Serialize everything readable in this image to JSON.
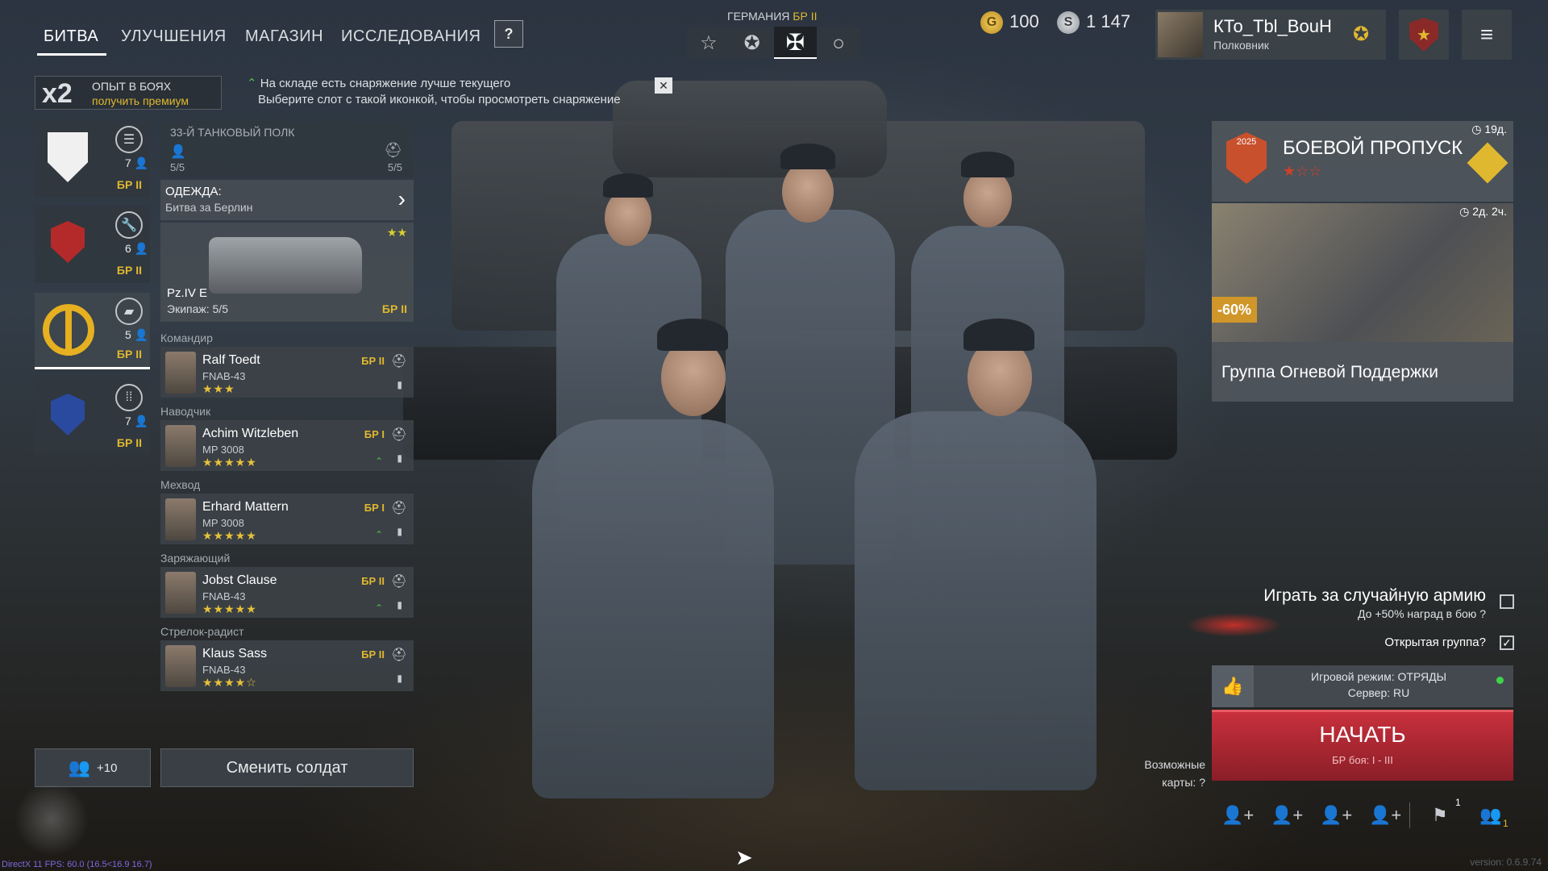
{
  "colors": {
    "accent_gold": "#e0b830",
    "start_red": "#c0303a",
    "bp_orange": "#c8502d",
    "online_green": "#3fd24a"
  },
  "nav": {
    "tabs": [
      "БИТВА",
      "УЛУЧШЕНИЯ",
      "МАГАЗИН",
      "ИССЛЕДОВАНИЯ"
    ],
    "help": "?"
  },
  "nation": {
    "name": "ГЕРМАНИЯ",
    "br": "БР II",
    "icons": [
      "star-icon",
      "circle-star-icon",
      "cross-icon",
      "circle-icon"
    ]
  },
  "currency": {
    "gold": "100",
    "silver": "1 147"
  },
  "player": {
    "name": "КТо_Tbl_BouH",
    "rank": "Полковник"
  },
  "xp_bonus": {
    "multiplier": "2",
    "label": "ОПЫТ В БОЯХ",
    "link": "получить премиум"
  },
  "notice": {
    "line1": "На складе есть снаряжение лучше текущего",
    "line2": "Выберите слот с такой иконкой, чтобы просмотреть снаряжение",
    "close": "✕"
  },
  "squads": [
    {
      "count": "7",
      "br": "БР II"
    },
    {
      "count": "6",
      "br": "БР II"
    },
    {
      "count": "5",
      "br": "БР II"
    },
    {
      "count": "7",
      "br": "БР II"
    }
  ],
  "regiment": {
    "name": "33-Й ТАНКОВЫЙ ПОЛК",
    "soldiers": "5/5",
    "vehicles": "5/5"
  },
  "outfit": {
    "label": "ОДЕЖДА:",
    "value": "Битва за Берлин"
  },
  "vehicle": {
    "name": "Pz.IV E",
    "crew": "Экипаж: 5/5",
    "br": "БР II",
    "stars": "★★"
  },
  "soldiers": [
    {
      "role": "Командир",
      "name": "Ralf Toedt",
      "weapon": "FNAB-43",
      "stars": "★★★",
      "br": "БР II"
    },
    {
      "role": "Наводчик",
      "name": "Achim Witzleben",
      "weapon": "MP 3008",
      "stars": "★★★★★",
      "br": "БР I"
    },
    {
      "role": "Мехвод",
      "name": "Erhard Mattern",
      "weapon": "MP 3008",
      "stars": "★★★★★",
      "br": "БР I"
    },
    {
      "role": "Заряжающий",
      "name": "Jobst Clause",
      "weapon": "FNAB-43",
      "stars": "★★★★★",
      "br": "БР II"
    },
    {
      "role": "Стрелок-радист",
      "name": "Klaus Sass",
      "weapon": "FNAB-43",
      "stars": "★★★★☆",
      "br": "БР II"
    }
  ],
  "squad_bottom": {
    "add_count": "+10",
    "change_button": "Сменить солдат"
  },
  "battle_pass": {
    "title": "БОЕВОЙ ПРОПУСК",
    "timer": "19д.",
    "year": "2025",
    "stars": "★☆☆"
  },
  "offer": {
    "timer": "2д. 2ч.",
    "discount": "-60%",
    "title": "Группа Огневой Поддержки"
  },
  "options": {
    "random_army": "Играть за случайную армию",
    "random_bonus": "До +50% наград в бою",
    "open_group": "Открытая группа"
  },
  "mode": {
    "line1": "Игровой режим: ОТРЯДЫ",
    "line2": "Сервер: RU"
  },
  "start": {
    "label": "НАЧАТЬ",
    "sub": "БР боя: I - III"
  },
  "maps": {
    "label1": "Возможные",
    "label2": "карты:"
  },
  "bottom_bar": {
    "flag_count": "1",
    "group_count": "1"
  },
  "debug": {
    "fps": "DirectX 11 FPS: 60.0 (16.5<16.9 16.7)",
    "version": "version: 0.6.9.74"
  }
}
